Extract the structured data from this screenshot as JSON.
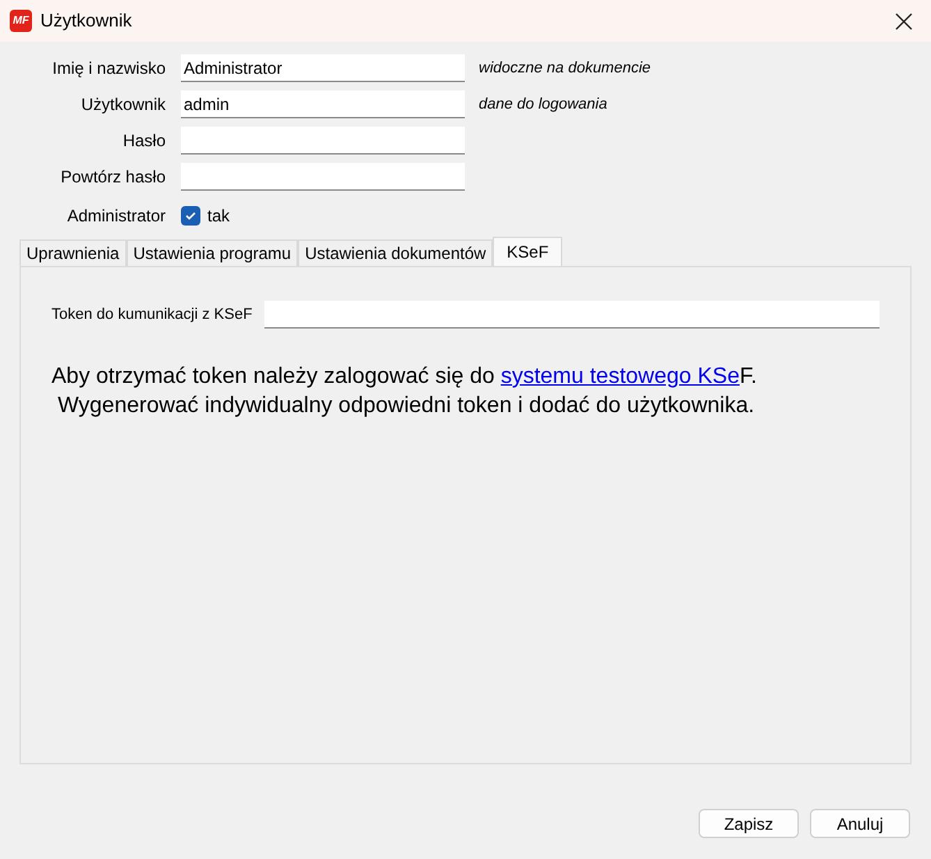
{
  "window": {
    "title": "Użytkownik",
    "logo": "MF"
  },
  "fields": [
    {
      "label": "Imię i nazwisko",
      "value": "Administrator",
      "hint": "widoczne na dokumencie"
    },
    {
      "label": "Użytkownik",
      "value": "admin",
      "hint": "dane do logowania"
    },
    {
      "label": "Hasło"
    },
    {
      "label": "Powtórz hasło"
    }
  ],
  "admin": {
    "label": "Administrator",
    "checked": true,
    "text": "tak"
  },
  "tabs": [
    {
      "label": "Uprawnienia",
      "selected": false
    },
    {
      "label": "Ustawienia programu",
      "selected": false
    },
    {
      "label": "Ustawienia dokumentów",
      "selected": false
    },
    {
      "label": "KSeF",
      "selected": true
    }
  ],
  "token": {
    "label": "Token do kumunikacji z KSeF"
  },
  "info": {
    "before": "Aby otrzymać token należy zalogować się do ",
    "link": "systemu testowego KSe",
    "after": "F.",
    "line2": " Wygenerować indywidualny odpowiedni token i dodać do użytkownika."
  },
  "buttons": [
    "Zapisz",
    "Anuluj"
  ]
}
